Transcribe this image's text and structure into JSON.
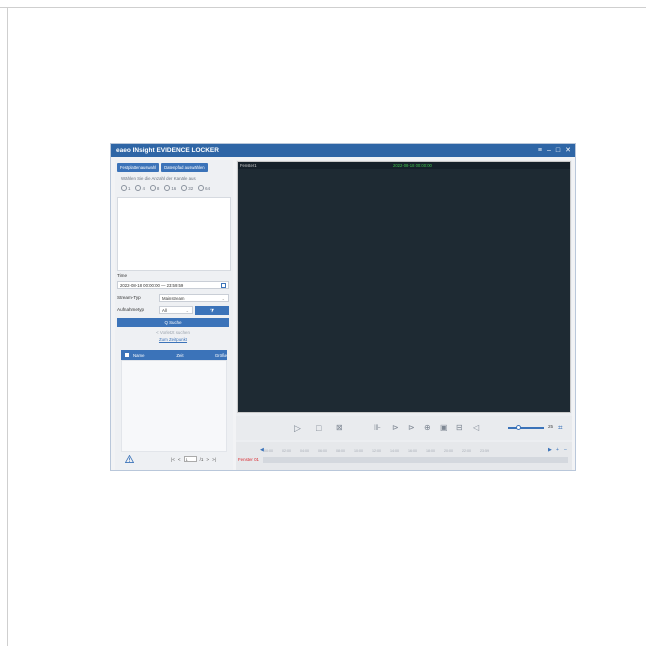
{
  "window": {
    "title": "eaeo INsight EVIDENCE LOCKER",
    "controls": [
      "≡",
      "–",
      "□",
      "✕"
    ]
  },
  "left_panel": {
    "buttons": [
      "Festplattenauswahl",
      "Datenpfad auswählen"
    ],
    "hint": "Wählen Sie die Anzahl der Kanäle aus",
    "channel_counts": [
      "1",
      "4",
      "8",
      "16",
      "32",
      "64"
    ],
    "time_label": "Time",
    "time_range": "2022-08-18 00:00:00 — 23:59:59",
    "stream_label": "Stream-Typ",
    "stream_value": "Mainstream",
    "record_label": "Aufnahmetyp",
    "record_value": "All",
    "filter_button": "⧩",
    "search_button": "Q  Suche",
    "prev_link": "< Vorletzt suchen",
    "timepoint_link": "Zum Zeitpunkt",
    "table_headers": [
      "Name",
      "Zeit",
      "Größe"
    ],
    "pager": {
      "first": "|<",
      "prev": "<",
      "page": "1",
      "total": "/1",
      "next": ">",
      "last": ">|"
    }
  },
  "player": {
    "window_label": "Fenster1",
    "timestamp": "2022-08-18 00:00:00",
    "volume": "25",
    "timeline_ticks": [
      "00:00",
      "02:00",
      "04:00",
      "06:00",
      "08:00",
      "10:00",
      "12:00",
      "14:00",
      "16:00",
      "18:00",
      "20:00",
      "22:00",
      "23:59"
    ],
    "track_name": "Fenster 01"
  },
  "colors": {
    "accent": "#3b73b9",
    "title_bar": "#2f66a6",
    "video_bg": "#1e2a33",
    "timestamp": "#3ec24a",
    "track_name": "#d9282f"
  }
}
